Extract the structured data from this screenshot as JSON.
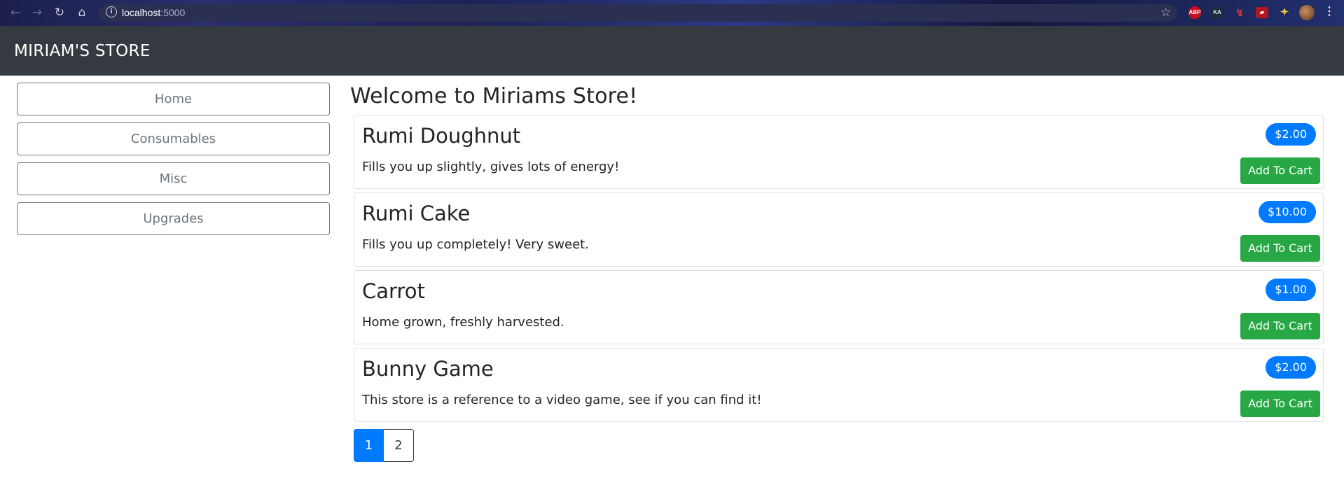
{
  "browser": {
    "back_icon": "←",
    "forward_icon": "→",
    "reload_icon": "↻",
    "home_icon": "⌂",
    "url_host": "localhost",
    "url_port": ":5000",
    "extensions": {
      "abp": "ABP",
      "ka": "KA",
      "hr": "↯",
      "book": "▰",
      "puzzle": "✦",
      "menu": "⋮"
    }
  },
  "navbar": {
    "brand": "MIRIAM'S STORE"
  },
  "sidebar": {
    "items": [
      {
        "label": "Home"
      },
      {
        "label": "Consumables"
      },
      {
        "label": "Misc"
      },
      {
        "label": "Upgrades"
      }
    ]
  },
  "main": {
    "title": "Welcome to Miriams Store!",
    "add_to_cart_label": "Add To Cart",
    "products": [
      {
        "name": "Rumi Doughnut",
        "description": "Fills you up slightly, gives lots of energy!",
        "price": "$2.00"
      },
      {
        "name": "Rumi Cake",
        "description": "Fills you up completely! Very sweet.",
        "price": "$10.00"
      },
      {
        "name": "Carrot",
        "description": "Home grown, freshly harvested.",
        "price": "$1.00"
      },
      {
        "name": "Bunny Game",
        "description": "This store is a reference to a video game, see if you can find it!",
        "price": "$2.00"
      }
    ]
  },
  "pagination": {
    "pages": [
      "1",
      "2"
    ],
    "active": "1"
  },
  "colors": {
    "navbar_bg": "#343a40",
    "primary": "#007bff",
    "success": "#28a745",
    "secondary": "#6c757d"
  }
}
